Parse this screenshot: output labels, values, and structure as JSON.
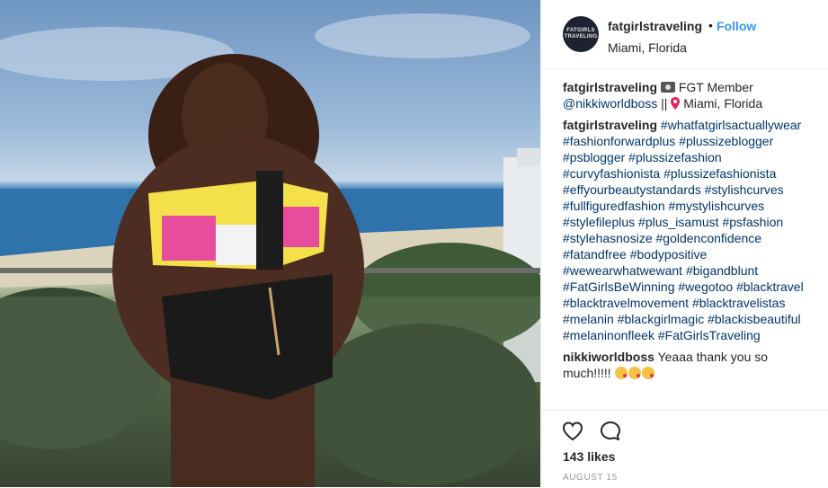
{
  "post": {
    "username": "fatgirlstraveling",
    "avatar_text": "FATGIRLS TRAVELING",
    "separator": "•",
    "follow_label": "Follow",
    "location": "Miami, Florida"
  },
  "caption": {
    "username": "fatgirlstraveling",
    "text_before": "FGT Member",
    "mention": "@nikkiworldboss",
    "text_after": "||",
    "place": "Miami, Florida"
  },
  "hashtag_comment": {
    "username": "fatgirlstraveling",
    "tags": [
      "#whatfatgirlsactuallywear",
      "#fashionforwardplus",
      "#plussizeblogger",
      "#psblogger",
      "#plussizefashion",
      "#curvyfashionista",
      "#plussizefashionista",
      "#effyourbeautystandards",
      "#stylishcurves",
      "#fullfiguredfashion",
      "#mystylishcurves",
      "#stylefileplus",
      "#plus_isamust",
      "#psfashion",
      "#stylehasnosize",
      "#goldenconfidence",
      "#fatandfree",
      "#bodypositive",
      "#wewearwhatwewant",
      "#bigandblunt",
      "#FatGirlsBeWinning",
      "#wegotoo",
      "#blacktravel",
      "#blacktravelmovement",
      "#blacktravelistas",
      "#melanin",
      "#blackgirlmagic",
      "#blackisbeautiful",
      "#melaninonfleek",
      "#FatGirlsTraveling"
    ]
  },
  "reply_comment": {
    "username": "nikkiworldboss",
    "text": "Yeaaa thank you so much!!!!!"
  },
  "actions": {
    "likes": "143 likes",
    "date": "August 15"
  },
  "colors": {
    "link": "#3897f0",
    "hashtag": "#003569",
    "border": "#efefef"
  }
}
